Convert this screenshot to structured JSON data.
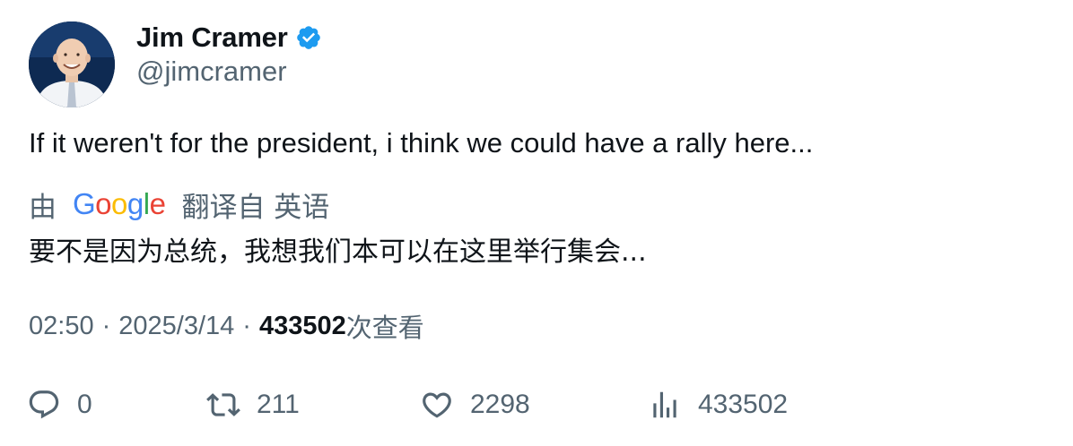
{
  "author": {
    "display_name": "Jim Cramer",
    "handle": "@jimcramer",
    "verified": true,
    "avatar_icon": "profile-photo"
  },
  "tweet": {
    "text": "If it weren't for the president, i think we could have a rally here..."
  },
  "translation": {
    "prefix": "由",
    "provider": "Google",
    "suffix": "翻译自 英语",
    "text": "要不是因为总统，我想我们本可以在这里举行集会..."
  },
  "meta": {
    "time": "02:50",
    "separator": "·",
    "date": "2025/3/14",
    "views_count": "433502",
    "views_label": "次查看"
  },
  "actions": {
    "replies": "0",
    "retweets": "211",
    "likes": "2298",
    "views": "433502"
  },
  "colors": {
    "text_primary": "#0f1419",
    "text_secondary": "#536471",
    "verified_blue": "#1d9bf0"
  }
}
